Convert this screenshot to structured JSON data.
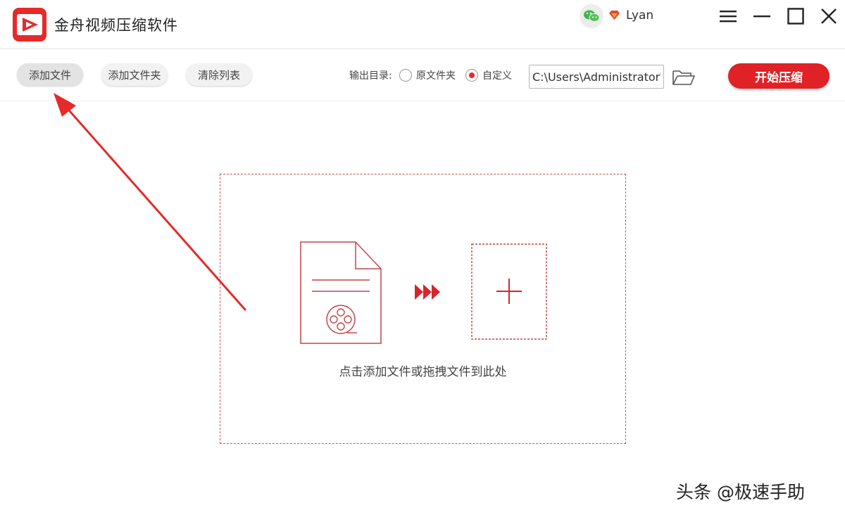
{
  "app": {
    "title": "金舟视频压缩软件",
    "username": "Lyan",
    "brand_color": "#e8292a"
  },
  "window_controls": {
    "menu_icon": "hamburger-menu-icon",
    "minimize_icon": "minimize-icon",
    "maximize_icon": "maximize-icon",
    "close_icon": "close-icon"
  },
  "toolbar": {
    "add_file_label": "添加文件",
    "add_folder_label": "添加文件夹",
    "clear_list_label": "清除列表",
    "output_dir_label": "输出目录:",
    "radio_original_label": "原文件夹",
    "radio_custom_label": "自定义",
    "selected_output": "自定义",
    "output_path": "C:\\Users\\Administrator\\",
    "start_label": "开始压缩"
  },
  "dropzone": {
    "hint": "点击添加文件或拖拽文件到此处"
  },
  "watermark": {
    "text": "头条 @极速手助"
  }
}
